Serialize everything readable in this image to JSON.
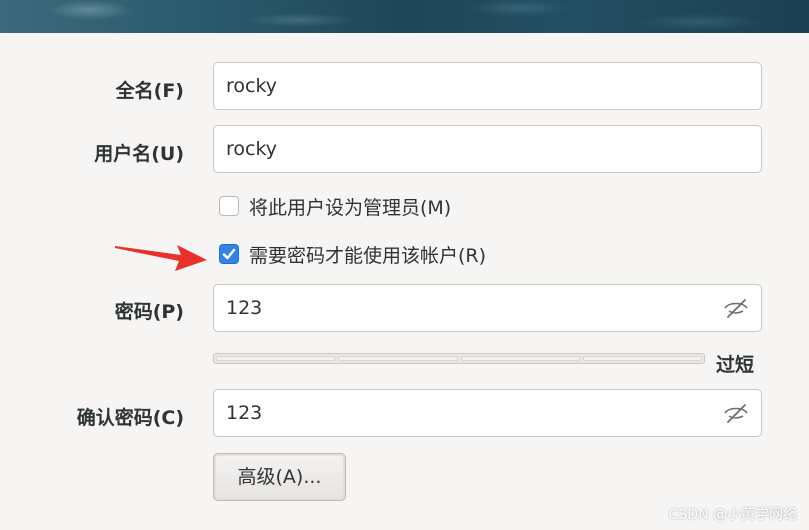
{
  "form": {
    "fullname_label": "全名(F)",
    "fullname_value": "rocky",
    "username_label": "用户名(U)",
    "username_value": "rocky",
    "admin_check_label": "将此用户设为管理员(M)",
    "admin_checked": false,
    "require_password_label": "需要密码才能使用该帐户(R)",
    "require_password_checked": true,
    "password_label": "密码(P)",
    "password_value": "123",
    "strength_text": "过短",
    "confirm_label": "确认密码(C)",
    "confirm_value": "123",
    "advanced_button": "高级(A)..."
  },
  "watermark": "CSDN @小黄学网络",
  "colors": {
    "accent": "#3584e4",
    "arrow": "#e8312a"
  },
  "icons": {
    "password_visibility": "eye-slash-icon",
    "confirm_visibility": "eye-slash-icon",
    "annotation": "red-arrow-icon"
  }
}
